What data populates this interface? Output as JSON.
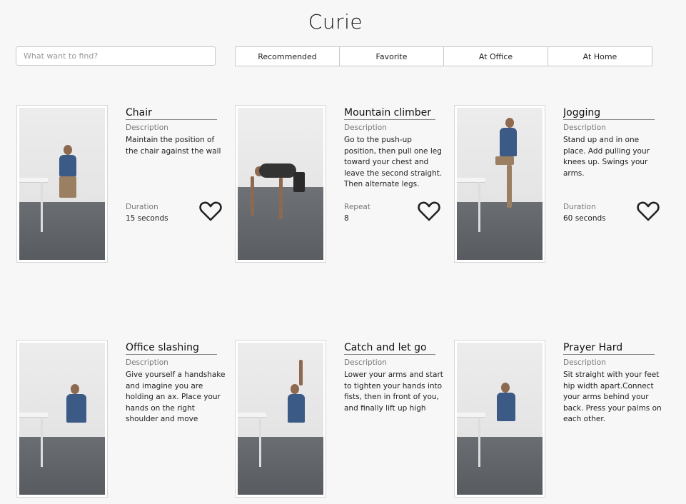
{
  "app": {
    "title": "Curie"
  },
  "search": {
    "placeholder": "What want to find?",
    "value": ""
  },
  "tabs": [
    {
      "label": "Recommended"
    },
    {
      "label": "Favorite"
    },
    {
      "label": "At Office"
    },
    {
      "label": "At Home"
    }
  ],
  "exercises": [
    {
      "name": "Chair",
      "description_label": "Description",
      "description": "Maintain the position of the chair against the wall",
      "metric_label": "Duration",
      "metric_value": "15 seconds",
      "favorite_icon": "heart-outline-icon"
    },
    {
      "name": "Mountain climber",
      "description_label": "Description",
      "description": "Go to the push-up position, then pull one leg toward your chest and leave the second straight. Then alternate legs.",
      "metric_label": "Repeat",
      "metric_value": "8",
      "favorite_icon": "heart-outline-icon"
    },
    {
      "name": "Jogging",
      "description_label": "Description",
      "description": "Stand up and in one place. Add pulling your knees up. Swings your arms.",
      "metric_label": "Duration",
      "metric_value": "60 seconds",
      "favorite_icon": "heart-outline-icon"
    },
    {
      "name": "Office slashing",
      "description_label": "Description",
      "description": "Give yourself a handshake and imagine you are holding an ax. Place your hands on the right shoulder and move",
      "metric_label": "",
      "metric_value": "",
      "favorite_icon": "heart-outline-icon"
    },
    {
      "name": "Catch and let go",
      "description_label": "Description",
      "description": "Lower your arms and start to tighten your hands into fists, then in front of you, and finally lift up high",
      "metric_label": "",
      "metric_value": "",
      "favorite_icon": "heart-outline-icon"
    },
    {
      "name": "Prayer Hard",
      "description_label": "Description",
      "description": "Sit straight with your feet hip width apart.Connect your arms behind your back. Press your palms on each other.",
      "metric_label": "",
      "metric_value": "",
      "favorite_icon": "heart-outline-icon"
    }
  ]
}
